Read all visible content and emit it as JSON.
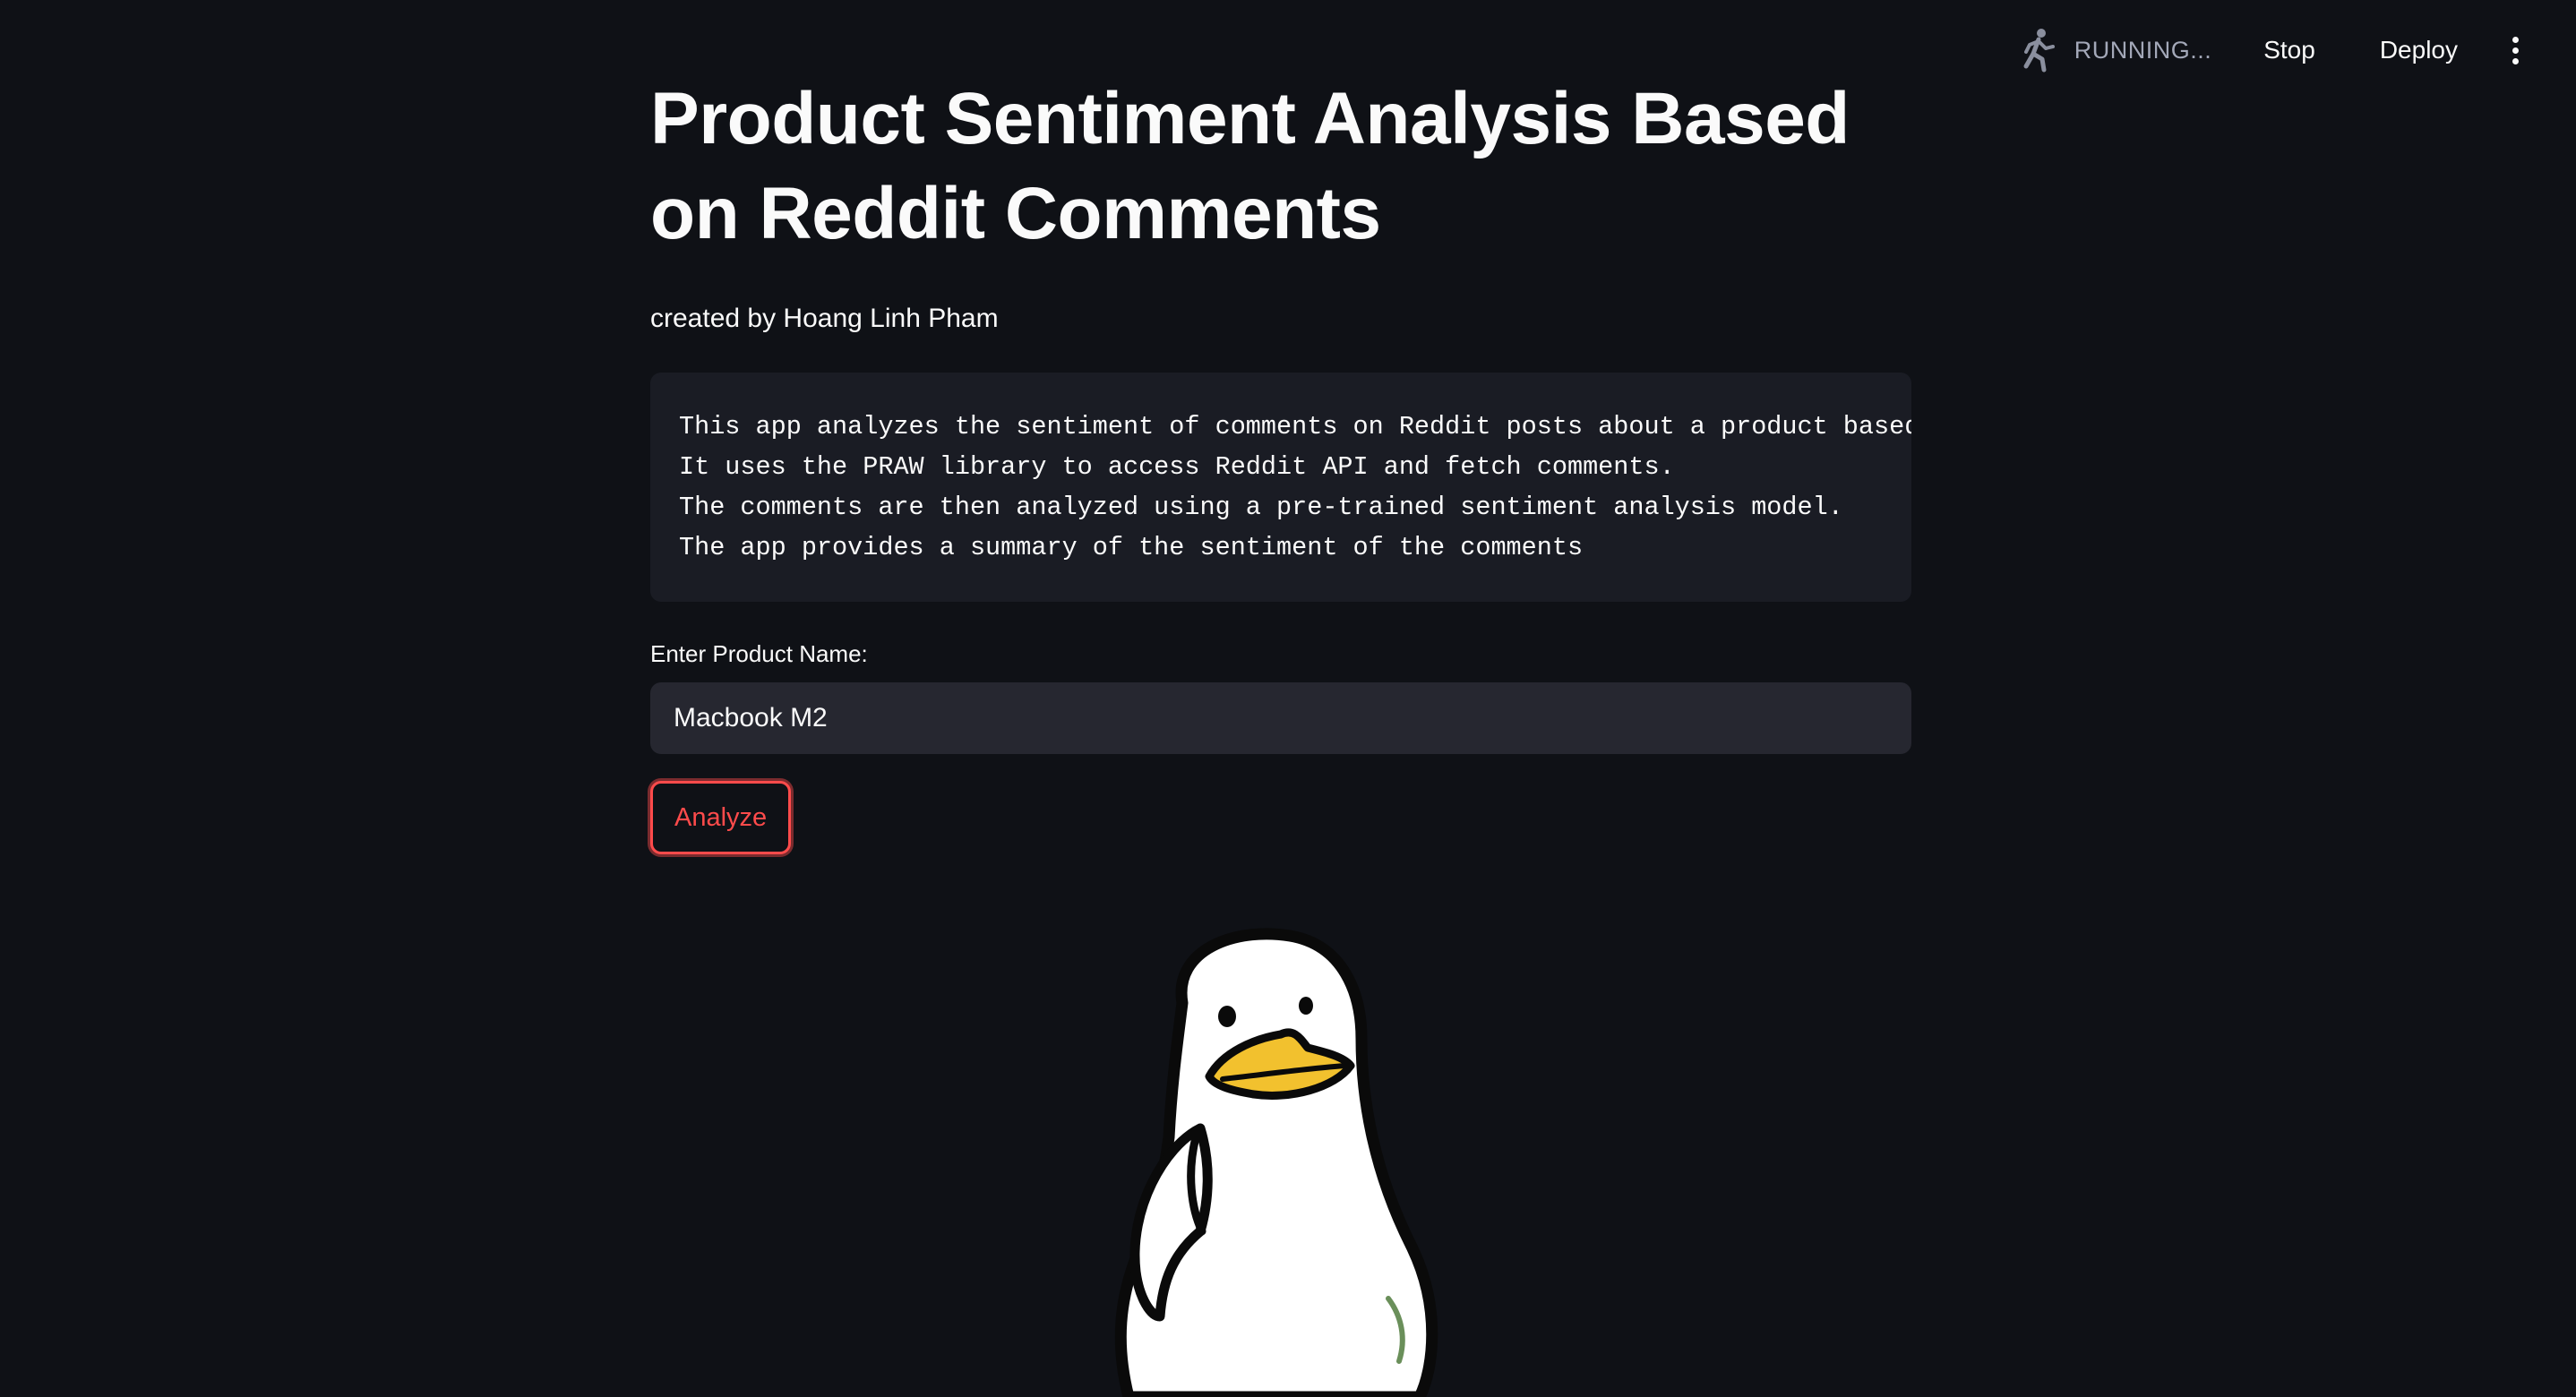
{
  "toolbar": {
    "status_label": "RUNNING...",
    "stop_label": "Stop",
    "deploy_label": "Deploy",
    "status_icon": "running-man-icon",
    "menu_icon": "vertical-ellipsis-icon"
  },
  "header": {
    "title_line1": "Product Sentiment Analysis Based",
    "title_line2": "on Reddit Comments",
    "subtitle": "created by Hoang Linh Pham"
  },
  "description": {
    "lines": [
      "This app analyzes the sentiment of comments on Reddit posts about a product based",
      "It uses the PRAW library to access Reddit API and fetch comments.",
      "The comments are then analyzed using a pre-trained sentiment analysis model.",
      "The app provides a summary of the sentiment of the comments"
    ]
  },
  "form": {
    "input_label": "Enter Product Name:",
    "input_value": "Macbook M2",
    "button_label": "Analyze"
  },
  "colors": {
    "background": "#0f1116",
    "code_background": "#1a1c24",
    "input_background": "#262730",
    "accent": "#ff4b4b",
    "duck_beak": "#f2c12e"
  },
  "illustration": {
    "icon": "duck-mascot-icon"
  }
}
